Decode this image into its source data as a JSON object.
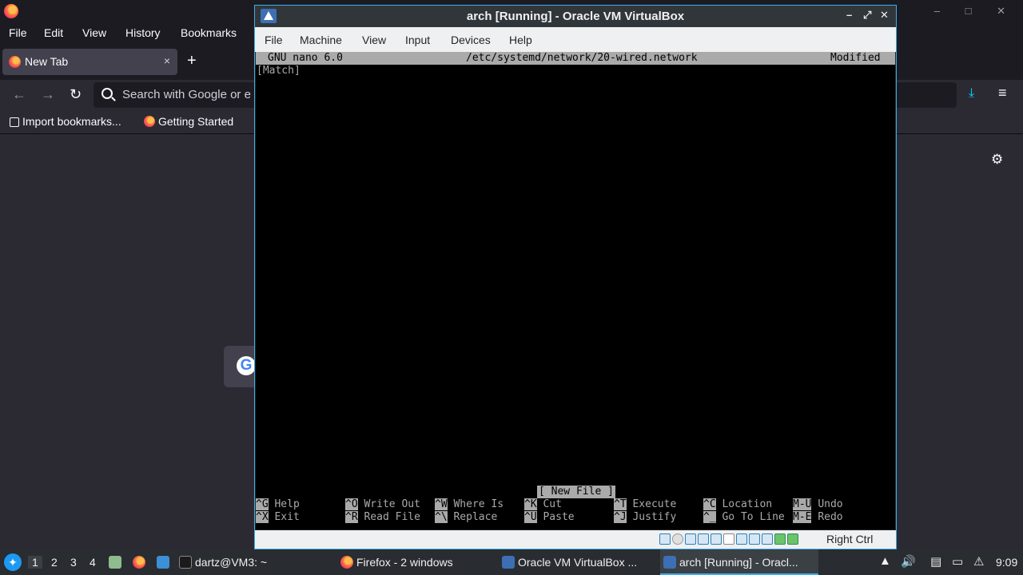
{
  "firefox": {
    "menu": [
      "File",
      "Edit",
      "View",
      "History",
      "Bookmarks"
    ],
    "tab_label": "New Tab",
    "tab_close": "×",
    "new_tab": "+",
    "url_placeholder": "Search with Google or e",
    "bookmarks": [
      "Import bookmarks...",
      "Getting Started"
    ],
    "google_letter": "G"
  },
  "vbox": {
    "title": "arch [Running] - Oracle VM VirtualBox",
    "ctrl_minimize": "–",
    "ctrl_maximize": "⤢",
    "ctrl_close": "✕",
    "menu": [
      "File",
      "Machine",
      "View",
      "Input",
      "Devices",
      "Help"
    ],
    "host_key": "Right Ctrl"
  },
  "nano": {
    "version": "GNU nano 6.0",
    "filename": "/etc/systemd/network/20-wired.network",
    "state": "Modified",
    "content_lines": [
      "[Match]"
    ],
    "status": "[ New File ]",
    "shortcuts_row1": [
      {
        "key": "^G",
        "label": "Help"
      },
      {
        "key": "^O",
        "label": "Write Out"
      },
      {
        "key": "^W",
        "label": "Where Is"
      },
      {
        "key": "^K",
        "label": "Cut"
      },
      {
        "key": "^T",
        "label": "Execute"
      },
      {
        "key": "^C",
        "label": "Location"
      },
      {
        "key": "M-U",
        "label": "Undo"
      }
    ],
    "shortcuts_row2": [
      {
        "key": "^X",
        "label": "Exit"
      },
      {
        "key": "^R",
        "label": "Read File"
      },
      {
        "key": "^\\",
        "label": "Replace"
      },
      {
        "key": "^U",
        "label": "Paste"
      },
      {
        "key": "^J",
        "label": "Justify"
      },
      {
        "key": "^_",
        "label": "Go To Line"
      },
      {
        "key": "M-E",
        "label": "Redo"
      }
    ]
  },
  "taskbar": {
    "workspaces": [
      "1",
      "2",
      "3",
      "4"
    ],
    "tasks": [
      {
        "label": "dartz@VM3: ~"
      },
      {
        "label": "Firefox - 2 windows"
      },
      {
        "label": "Oracle VM VirtualBox ..."
      },
      {
        "label": "arch [Running] - Oracl..."
      }
    ],
    "clock": "9:09"
  },
  "colors": {
    "accent": "#3daee9",
    "terminal_bg": "#000000",
    "terminal_fg": "#aaaaaa"
  }
}
